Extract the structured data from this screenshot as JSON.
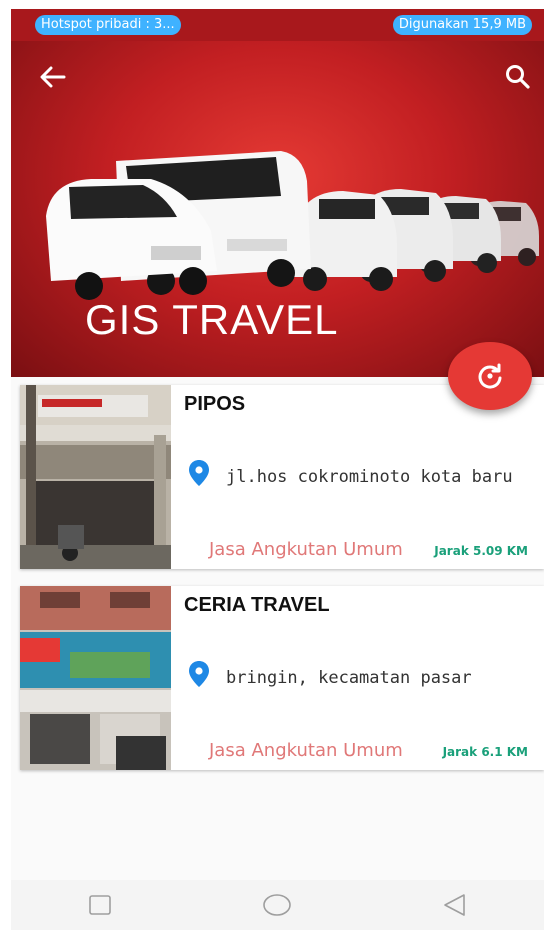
{
  "status_bar": {
    "hotspot": "Hotspot pribadi : 3...",
    "data_usage": "Digunakan 15,9 MB"
  },
  "header": {
    "title": "GIS TRAVEL",
    "back_icon": "arrow-left-icon",
    "search_icon": "search-icon",
    "fab_icon": "refresh-icon"
  },
  "travels": [
    {
      "name": "PIPOS",
      "address": "jl.hos cokrominoto kota baru",
      "category": "Jasa Angkutan Umum",
      "distance": "Jarak 5.09 KM"
    },
    {
      "name": "CERIA TRAVEL",
      "address": "bringin, kecamatan pasar",
      "category": "Jasa Angkutan Umum",
      "distance": "Jarak 6.1 KM"
    }
  ],
  "navbar": {
    "recent": "square-icon",
    "home": "circle-icon",
    "back": "triangle-back-icon"
  },
  "colors": {
    "header_red": "#c21f22",
    "fab_red": "#e53935",
    "category_text": "#e07878",
    "distance_text": "#1aa07a",
    "pin_blue": "#1e88e5",
    "pill_blue": "#3fb2ff"
  }
}
